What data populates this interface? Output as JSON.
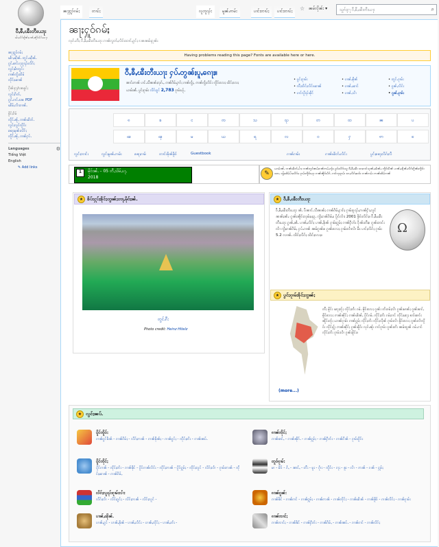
{
  "logo": {
    "wordmark": "ဝီႇၶီႇၽီးတီးယႃး",
    "tagline": "ၽၢႆႇလိၵ်ႈၵိူၼ်ႈပၢၼ်ႇၼိူဝ်းပႅၵ်ႉသႃး"
  },
  "nav": {
    "items": [
      "ၼႃႈႁူဝ်ၵမ်ႈ",
      "ၽၢႆႇၽိုၼ်ႉ တွင်ႉၽိုၼ်ႉ",
      "ၵွင်ႉၶၢင်ပႃးၵူၺ်းလိၵ်ႈ",
      "လွင်ႈမၢႆတွင်း",
      "ၵၢၼ်ၸွႆႈထႅမ်",
      "ၸိုင်ႈၽၢၼ်"
    ],
    "hd1": "ၵိုၼ်းႁႃ/ၼႄၶွင်ႈ",
    "items2": [
      "လွင်ႈၵႅတ်ႇ",
      "ၵွင်ႉၵၢင်ႉၼႄ PDF",
      "ၽိမ်ႇလၢႆးၵၢၼ်ႉ"
    ],
    "hd2": "ၶိူင်ႈၵႅမ်",
    "items3": [
      "ၸိူင်ႉၼႂ်ႇ ၵၢၼ်ၽိတ်ႉ",
      "လွင်ႈလွင်ၸိူဝ်း",
      "ၶေႃႈမုၼ်းလိၵ်ႈ",
      "ၸိူင်ႉၼႂ်ႇ ၵၢၼ်ႁပ်ႉ"
    ],
    "lang_hd": "Languages",
    "langs": [
      "Tiếng Việt",
      "English"
    ],
    "add_links": "Add links"
  },
  "tabs": {
    "main": "ၼႃႈႁူဝ်ၵမ်ႈ",
    "talk": "တၢပ်ႈ",
    "read": "လူတူၺ်း",
    "edit": "မူၼ်ႉဢမ်း",
    "history": "ပၢင်းတၢပ်ႈ",
    "more": "ၼမ်လိုၼ်း"
  },
  "search": {
    "placeholder": "သွၵ်ႈႁႃ ဝီႇၶီႇၽီးတီးယႃး"
  },
  "page": {
    "title": "ၼႃႈႁူဝ်ၵမ်ႈ",
    "subtitle": "လုၵ်ႉတီႈ ဝီႇၶီႇၽီးတီးယႃး ၵၢၼ်လွတ်ႇလႅဝ်းထၢင်ႇၵွင်ႈ ၼႄၼမ်ႈႁုၼ်း",
    "font_note": "Having problems reading this page? Fonts are available here or here."
  },
  "welcome": {
    "title": "ဝီႇၶီႇၽီးတီးယႃး ႁပ်ႉတွၼ်ႈပူႇၵေႃႈ။",
    "line1": "ၼၢင်းဢၼ် ပၢင်ႉသီၼၼ်ႈလုၵ်ႉ, ၵၢၼ်ၵႅမ်ႇႁၢၵ်ႈ ၵၢၼ်ၸွႆႈ, ဢၼ်ၸွႆႈလႅင်း ၸိူဝ်းလႄႈ ထႅင်ႈလႄႈ",
    "line2_pre": "ယၢမ်းၼႆႉ ပွင်ႈၵႂၢမ်း",
    "line2_link": "လိၵ်ႈၵွင်",
    "line2_count": "2,783",
    "line2_post": "ၵႂၢမ်းယႂ်ႇ"
  },
  "portals": [
    [
      "ပွင်ႈၵႂၢမ်း",
      "ပၢၼ်ႇၶိုၼ်",
      "တွင်ႉၵႂၢမ်း"
    ],
    [
      "ၸီႈထႅင်ႈလႅင်းၽၢၼ်",
      "ပၢၼ်ႇၽၢင်",
      "ၵွၼ်ႇလႅင်း"
    ],
    [
      "ပၢင်လိူၺ်းၶိုင်",
      "ပၢၼ်ႇသၢႆ",
      "ၵွၼ်ႇၵႂၢမ်း"
    ]
  ],
  "alphabet": [
    "ၵ",
    "ၶ",
    "င",
    "ၸ",
    "သ",
    "ၺ",
    "တ",
    "ထ",
    "ၼ",
    "ပ",
    "ၽ",
    "ၾ",
    "မ",
    "ယ",
    "ရ",
    "လ",
    "ဝ",
    "ႁ",
    "ဢ",
    "ၿ"
  ],
  "bottom_links": [
    "လွင်ႈတၢင်း",
    "လွင်ႈမူၼ်ႉဢမ်း",
    "ၶေႃႈၵၢမ်",
    "တၢင်းၶိုၼ်ၶိူဝ်",
    "Guestbook",
    "ၵၢၼ်ၵၢမ်း",
    "ၵၢၼ်ၽိတ်ႉလႅင်း",
    "ပွင်ႈၶေႃႈလိၵ်ႈလီ"
  ],
  "date": {
    "line1": "မိုဝ်းၼႆႉ –",
    "line2": "05 တီႇသိမ်ႇပႃႇ",
    "line3": "2018",
    "cal": "1"
  },
  "notice": "ယၢမ်းၼႆႉ ၵၢၼ်ၽိတ်ႉပၢႆႈ ၵၢၼ်တူဝ်ၼမ်ႈၵၼ်ဢမ်ႇၸႂ်ႈ၊ ၵွင်ႈလိၵ်ႈသူ ဝီႇၶီႇၽီး ၵႄႈၵၢင်သုၼ်ႇၽႅၼ်ႇ၊ ၸိူဝ်းပဵၼ် ပၢၼ်ႇၽိုၼ်ႉလိၵ်ႈၵိူၼ်ႈၸိူဝ်းတႄႉ ၸွႆႈထႅမ်ပၢႆႈလိၵ်ႈ၊ ၵႂၢမ်းၸိူဝ်းမႃး ၵၢၼ်ၼိူဝ်းပႅၵ်ႉ ၵၢင်ၵႃႈၵႂၢမ်း ၵႄႇလိၵ်ႈၶၢဝ်း ၵၢၼ်ၵၢမ်း ဢၼ်ထႅမ်ၵၢၼ်",
  "featured_pic": {
    "heading": "ၶိပ်းႁုပ်ႈၶိုင်ႈတွၼ်ႈတႃႇမိုဝ်ႈၼႆႉ",
    "caption": "တွင်ႉၵီး",
    "credit_label": "Photo credit:",
    "credit_name": "Heinz Hitelz"
  },
  "article": {
    "heading": "ဝီႇၶီႇၽီးတီးယႃး",
    "text": "ဝီႇၶီႇၽီးတီးယႃး ၼႆႉ ပီၼၢင်ႉသီၼၼ်ႈ ၵၢၼ်ၵႅမ်ႇႁၢၵ်ႈ ၵႂၢမ်းဝူၺ်ႇဢၼ်ႁၢႆႇလူင် ၼၼ်ႈၼႆႉ၊ ၵူၼ်းၼိူဝ်းလုမ်ႈၾႃႉ ၸွႆႈၵၼ်ၵႅမ်ႇ။ ပိူင်လၢႆး 2001 ၶိူဝ်းလိၵ်ႈ။ ဝီႇၶီႇၽီးတီးယႃး ၵွၼ်ႇၼႆႉ ပၢၼ်ႇလိၵ်ႈ ပၢၼ်ႇၶိုၼ် ၵႂၢမ်းႁူမ်ႈ ၵၢၼ်ႁဵတ်း ဝိုၼ်းတီႈ။ ၵူၼ်းတင်းလၢႆ ၸွႆႈၵၼ်ၵႅမ်ႇ ႁပ်ႉၵၢၼ် ၼမ်ၵူၼ်း။ ၵူၼ်းလႄႈ ၵႂၢမ်းလၢႆလၢႆ မီး ပၢင်ႈလိၵ်ႈ ၵႂၢမ်း 5.2 လၢၼ်ႉ ထႅင်ႈလိၵ်ႈ ထႅင်ႈလႄႈ။"
  },
  "map_section": {
    "heading": "ပွင်ႈၵႂၢမ်းၶိုင်ႈတွၼ်ႈ",
    "text": "တီႈ မိူင်း ၽႃႈတႂ်ႈ ၸိုင်ႈတႆး ၵမ်ႉ ၶိူဝ်းလႄႈ ၵူၼ်း တႆးၵမ်ႈလၢႆ ၵူၼ်းမၢၼ်ႈ ၵူၼ်းၶၢင်ႇ ၶိူဝ်းလႄႈ ဢၼ်ၼိုင်ႈ ၵၢၼ်ၽႅၼ်ႇ ပိူင်ၵမ်ႉ ၸိုင်ႈတႆး ၵမ်ႈၵၢင် ၸိုင်ႈၽႃႈ ၶၢဝ်းၶၢဝ်း ၼိူင်းတႂ်ႈ ယၢၼ်ၵႂၢမ်း ၵၢၼ်ႁူမ်ႈ ၸိုင်ႈတႆး ၸိုင်ႈလိုၼ် ၵႂၢမ်းလၢႆ ၶိူဝ်းလႄႈ ၵူၼ်းလၢႆၸိူဝ်း ၸိုင်ႈႁႂ်ႈ ဢၼ်ၼိုင်ႈ ၵူၼ်းၶိူဝ်း လုၵ်ႉၼႂ်း ၵၢင်ၵႂၢမ်း ၵူၼ်းတႆး ၼမ်ထွၼ် ၵမ်ႉၵၢင် ၸိုင်ႈတႆး ၵႂၢမ်းလၢႆ ၵူၼ်းမိူင်း။",
    "more": "(more...)"
  },
  "categories": {
    "heading": "လွင်ႈၼပ်ႉ",
    "items": [
      {
        "title": "ပိူင်ၸိူဝ်း",
        "links": "ၵၢၼ်ၵွင်ၶႅၼ် - ၵၢၼ်ၵႅမ်ႈ - လိၵ်ႈဢၼ် - ၵၢၼ်ၶိုၼ်ႈ - ၵၢၼ်ၵွင်ႈ - ၸိုင်ႈတႆး - ၵၢၼ်ၼပ်ႉ"
      },
      {
        "title": "ၵၢၼ်ၸိုင်ႈ",
        "links": "ၵၢၼ်ၶၢင်ႇ - ၵၢၼ်ၼိုၵ်ႉ - ၵၢၼ်ႁူမ်ႈ - ၵၢၼ်ႁဵတ်း - ၵၢၼ်ၵိၼ် - ၵႂၢမ်းၵိူဝ်း"
      },
      {
        "title": "ပိူင်ၸိုင်ႈ",
        "links": "ပိူင်ၵၢၼ် - ၸိုင်ႈတႆး - ၵၢၼ်ၶိုင် - ပိူင်ၵၢၼ်လႅင်း - ၸိုင်ႈဢၼ် - ပိူင်ႁူမ်ႈ - ၸိုင်ႈလူင် - လိၵ်ႈလၢႆ - ၵႂၢမ်းဢၼ် - ၸိုင်ႈၽၢၼ် - ၵၢၼ်ၵႅမ်ႇ"
      },
      {
        "title": "တူဝ်ၵႂၢမ်း",
        "links": "မၢ - မိဝ် - ၵႆႇ - ၼၢင်ႇ - တီး - မူး - ၵႂၢႆး - ၸိူဝ်း - ၵႃႈ - ၶူး - လၢႆ - ဢၼ် - ၵၼ် - ႁူမ်ႈ"
      },
      {
        "title": "လိၵ်ႈလူၺ်းၵႂၢမ်းလၢႆး",
        "links": "လိၵ်ႈလၢႆ - လိၵ်ႈၵွင်ႈ - လိၵ်ႈဢၼ် - လိၵ်ႈလူင် -"
      },
      {
        "title": "ၵၢၼ်ၵူၼ်း",
        "links": "ၵၢၼ်ၶႅင် - ၵၢၼ်ၵၢင် - ၵၢၼ်ႁူမ်ႈ - ၵၢၼ်ဢၼ် - ၵၢၼ်ၸိုင်ႈ - ၵၢၼ်ၽႅၼ် - ၵၢၼ်ၶိူဝ် - ၵၢၼ်လိၵ်ႈ - ၵၢၼ်ၵႂၢမ်း"
      },
      {
        "title": "ပၢၼ်ႇၽိုၼ်ႉ",
        "links": "ပၢၼ်ႇၵွင် - ပၢၼ်ႇၶိုၼ် - ပၢၼ်ႇလႅင်း - ပၢၼ်ႇၸိုင်ႈ - ပၢၼ်ႇတႆး -"
      },
      {
        "title": "ၵၢၼ်ၸၢင်ႈ",
        "links": "ၵၢၼ်ၸၢင်ႈ - ၵၢၼ်ၶႅင် - ၵၢၼ်ႁဵတ်း - ၵၢၼ်ၵႅမ်ႇ - ၵၢၼ်ၼပ်ႉ - ၵၢၼ်ၵၢင် - ၵၢၼ်လိၵ်ႈ"
      }
    ]
  }
}
